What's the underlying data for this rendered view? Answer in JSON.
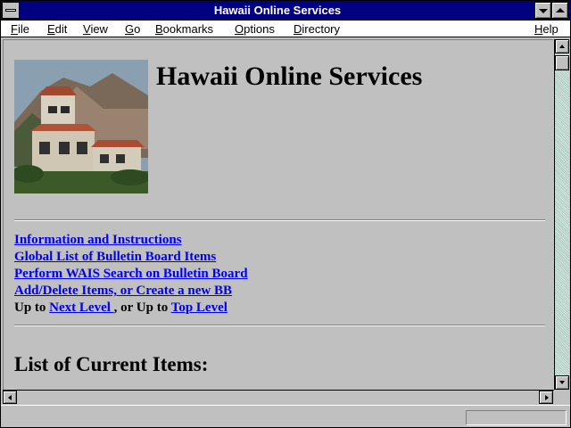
{
  "window": {
    "title": "Hawaii Online Services"
  },
  "menubar": {
    "items": [
      {
        "label": "File"
      },
      {
        "label": "Edit"
      },
      {
        "label": "View"
      },
      {
        "label": "Go"
      },
      {
        "label": "Bookmarks"
      },
      {
        "label": "Options"
      },
      {
        "label": "Directory"
      },
      {
        "label": "Help"
      }
    ]
  },
  "page": {
    "heading": "Hawaii Online Services",
    "links": [
      {
        "label": "Information and Instructions"
      },
      {
        "label": "Global List of Bulletin Board Items"
      },
      {
        "label": "Perform WAIS Search on Bulletin Board"
      },
      {
        "label": "Add/Delete Items, or Create a new BB"
      }
    ],
    "nav": {
      "prefix": "Up to ",
      "next_link": "Next Level ",
      "middle": ", or Up to ",
      "top_link": "Top Level "
    },
    "section_heading": "List of Current Items:"
  },
  "colors": {
    "titlebar": "#000080",
    "link": "#0000ee",
    "background": "#c0c0c0"
  },
  "icons": {
    "system_menu": "system-menu-icon",
    "minimize": "minimize-icon",
    "maximize": "maximize-icon",
    "photo": "building-photo"
  }
}
